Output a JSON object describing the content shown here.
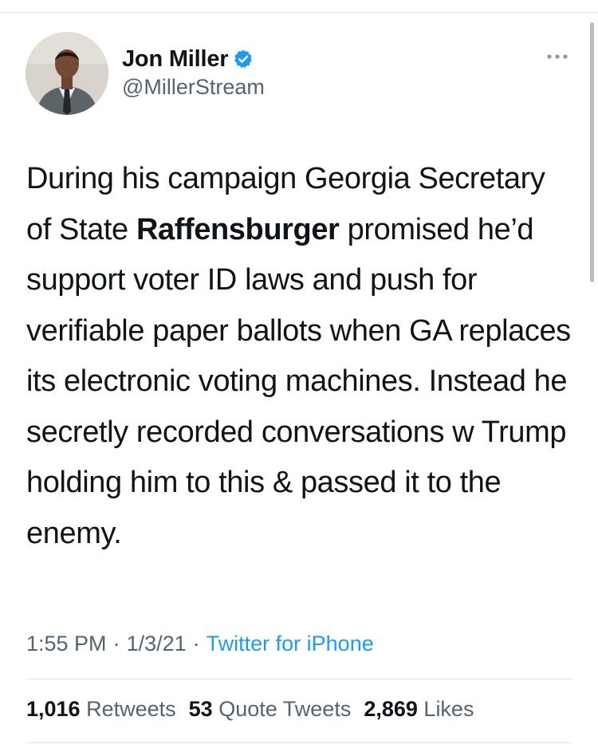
{
  "tweet": {
    "author": {
      "display_name": "Jon Miller",
      "handle": "@MillerStream"
    },
    "text_parts": [
      "During his campaign Georgia Secretary of State ",
      "Raffensburger",
      " promised he’d support voter ID laws and push for verifiable paper ballots when GA replaces its electronic voting machines. Instead he secretly recorded conversations w Trump holding him to this & passed it to the enemy."
    ],
    "time": "1:55 PM",
    "date": "1/3/21",
    "source": "Twitter for iPhone",
    "separator": "·",
    "stats": {
      "retweets": {
        "count": "1,016",
        "label": "Retweets"
      },
      "quote_tweets": {
        "count": "53",
        "label": "Quote Tweets"
      },
      "likes": {
        "count": "2,869",
        "label": "Likes"
      }
    }
  },
  "icons": {
    "verified": "verified-badge-icon",
    "more": "more-options-icon"
  },
  "colors": {
    "accent": "#1d9bf0",
    "text": "#0f1419",
    "secondary": "#536471",
    "divider": "#e3e6e8"
  }
}
